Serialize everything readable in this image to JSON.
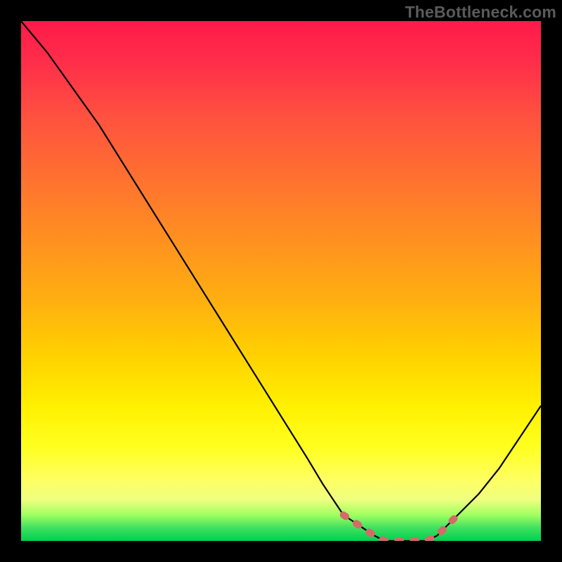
{
  "watermark": "TheBottleneck.com",
  "chart_data": {
    "type": "line",
    "title": "",
    "xlabel": "",
    "ylabel": "",
    "xlim": [
      0,
      100
    ],
    "ylim": [
      0,
      100
    ],
    "grid": false,
    "legend": false,
    "colors": {
      "gradient_top": "#ff1a4a",
      "gradient_bottom": "#00d050",
      "curve": "#000000",
      "markers": "#d46a6a",
      "frame": "#000000"
    },
    "series": [
      {
        "name": "bottleneck-curve",
        "x": [
          0,
          5,
          10,
          15,
          20,
          25,
          30,
          35,
          40,
          45,
          50,
          55,
          58,
          60,
          62,
          65,
          68,
          70,
          73,
          76,
          78,
          80,
          82,
          85,
          88,
          92,
          96,
          100
        ],
        "y": [
          100,
          94,
          87,
          80,
          72,
          64,
          56,
          48,
          40,
          32,
          24,
          16,
          11,
          8,
          5,
          3,
          1,
          0,
          0,
          0,
          0,
          1,
          3,
          6,
          9,
          14,
          20,
          26
        ]
      }
    ],
    "markers": {
      "name": "optimal-range",
      "x": [
        62,
        65,
        68,
        70,
        72,
        74,
        76,
        78,
        80,
        82,
        84
      ],
      "y": [
        5,
        3,
        1,
        0,
        0,
        0,
        0,
        0,
        1,
        3,
        5
      ]
    }
  }
}
